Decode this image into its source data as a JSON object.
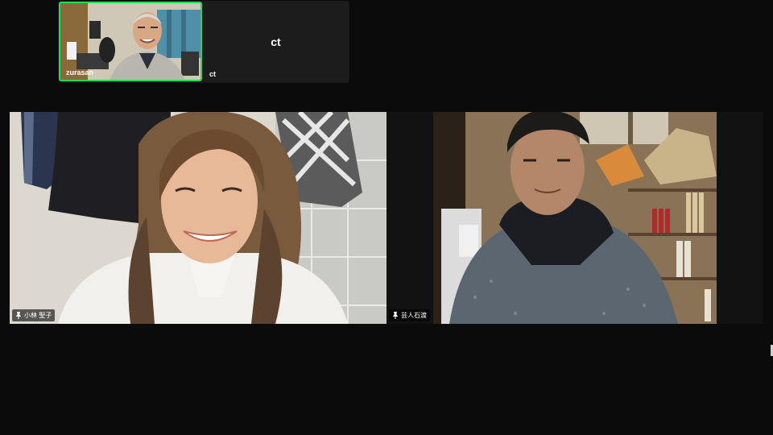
{
  "meeting": {
    "gallery_strip": {
      "participants": [
        {
          "name": "zurasan",
          "speaking": true
        },
        {
          "name": "ct",
          "video_off": true,
          "display_name_center": "ct"
        }
      ]
    },
    "main_tiles": [
      {
        "name": "小林 聖子",
        "pinned": true
      },
      {
        "name": "芸人石渡",
        "pinned": true
      }
    ]
  },
  "colors": {
    "background": "#0b0b0b",
    "tile_background": "#1a1a1a",
    "active_speaker_border": "#23d959",
    "name_text": "#ffffff"
  },
  "icons": {
    "pin": "pin-icon"
  }
}
